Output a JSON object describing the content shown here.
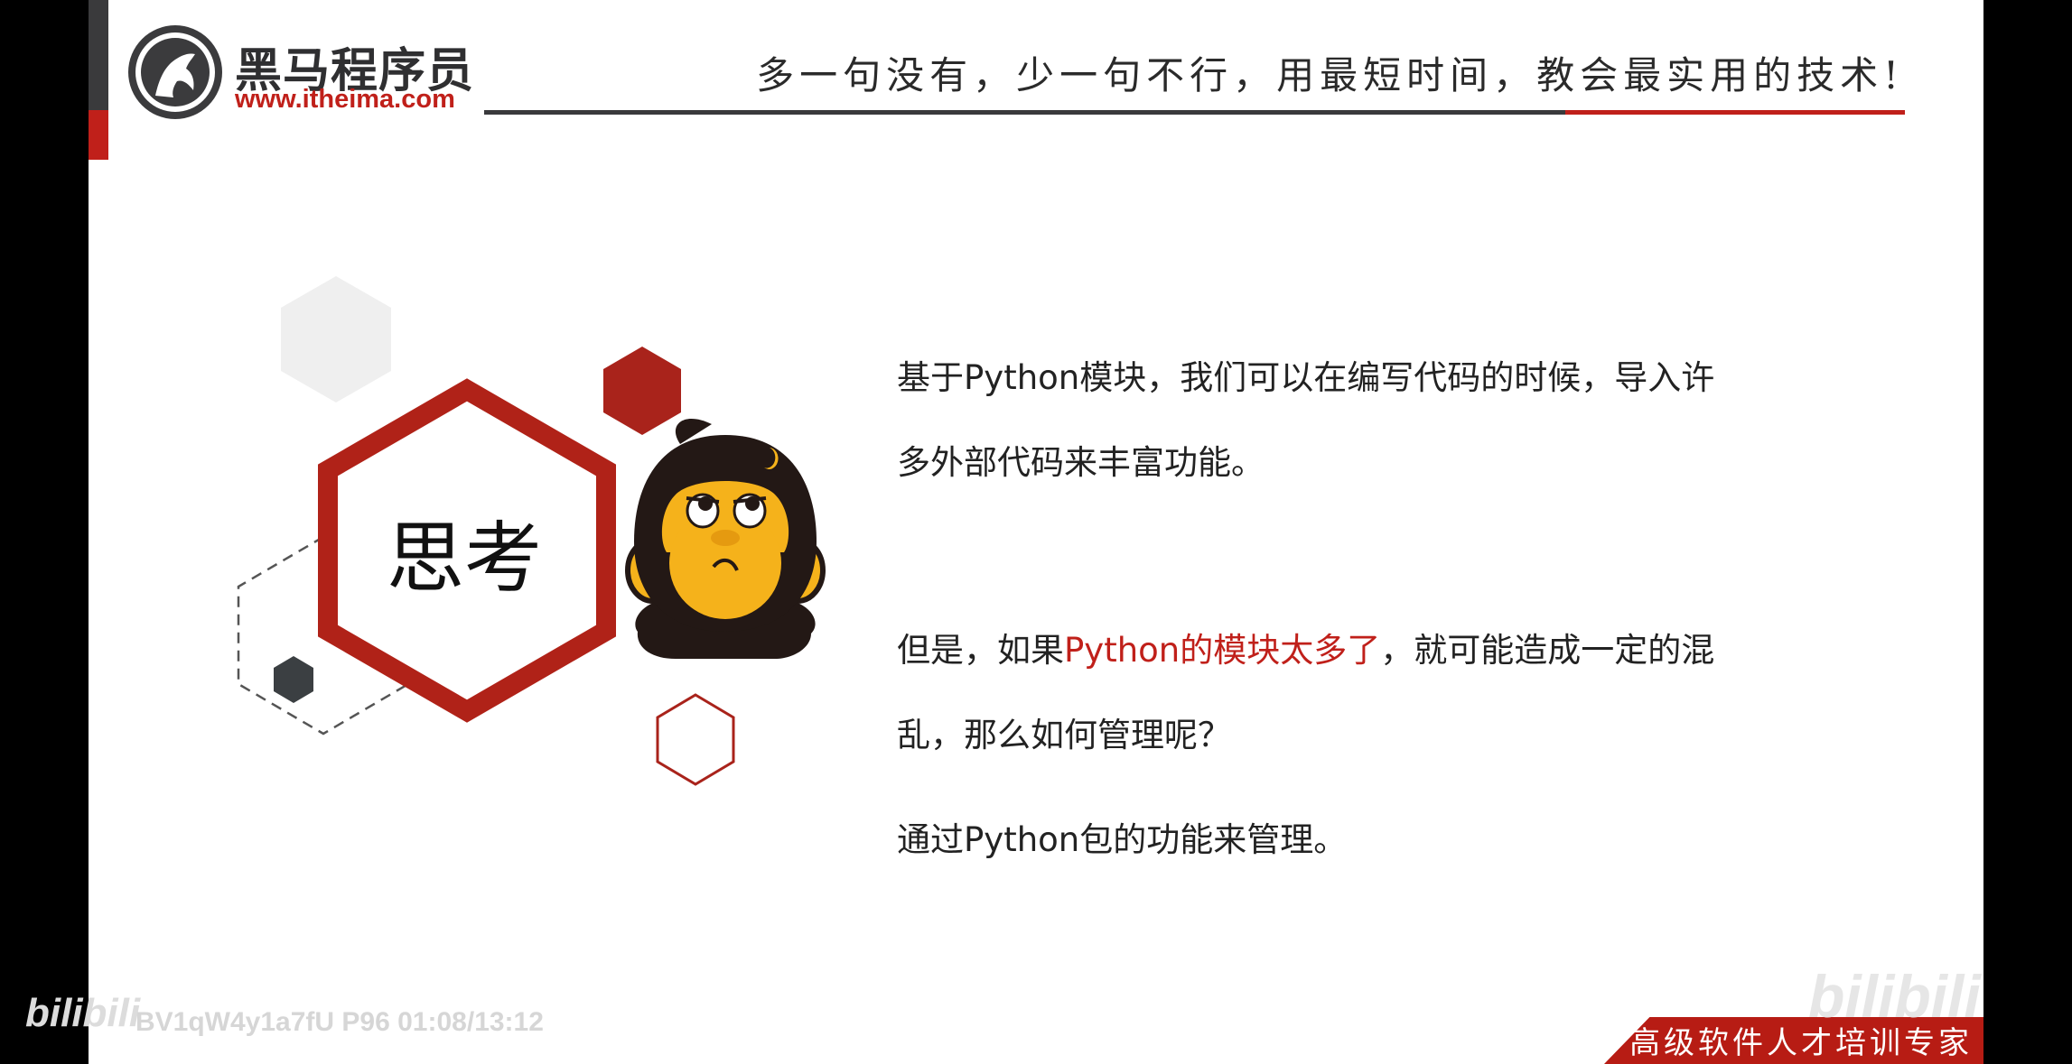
{
  "header": {
    "logo_title": "黑马程序员",
    "logo_url": "www.itheima.com",
    "slogan": "多一句没有，少一句不行，用最短时间，教会最实用的技术!"
  },
  "graphic": {
    "label": "思考",
    "mascot_icon": "thinking-monkey-mascot"
  },
  "content": {
    "p1_line1": "基于Python模块，我们可以在编写代码的时候，导入许",
    "p1_line2": "多外部代码来丰富功能。",
    "p2_line1_pre": "但是，如果",
    "p2_line1_red": "Python的模块太多了",
    "p2_line1_post": "，就可能造成一定的混",
    "p2_line2": "乱，那么如何管理呢？",
    "p3": "通过Python包的功能来管理。"
  },
  "footer": {
    "banner": "高级软件人才培训专家"
  },
  "watermark": {
    "logo": "bilibili",
    "video_info": "BV1qW4y1a7fU P96 01:08/13:12",
    "logo_right": "bilibili"
  },
  "colors": {
    "brand_red": "#c0201a",
    "dark_gray": "#3a3a3c",
    "mascot_orange": "#f5b21b"
  }
}
